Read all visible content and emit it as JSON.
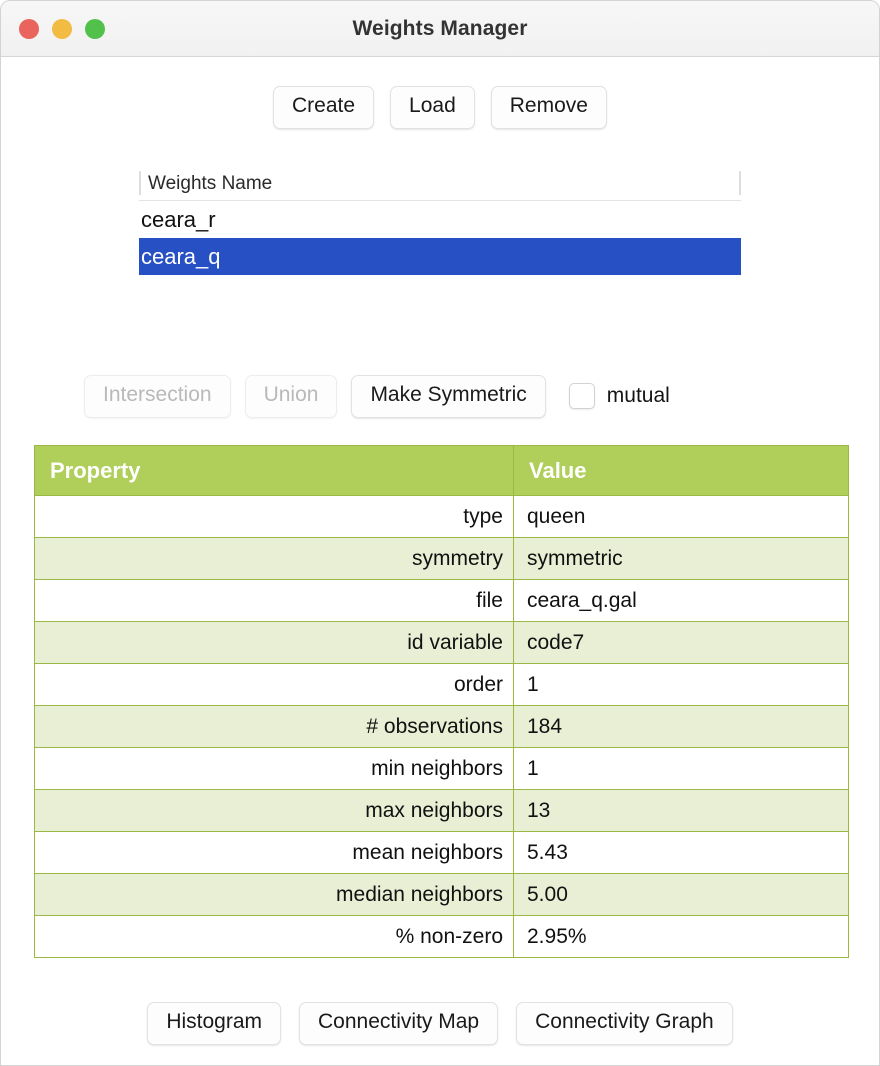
{
  "window": {
    "title": "Weights Manager",
    "traffic_lights": [
      {
        "name": "close-button",
        "color": "#e9645c"
      },
      {
        "name": "minimize-button",
        "color": "#f2bb41"
      },
      {
        "name": "maximize-button",
        "color": "#51c14c"
      }
    ]
  },
  "toolbar": {
    "create_label": "Create",
    "load_label": "Load",
    "remove_label": "Remove"
  },
  "weights_list": {
    "column_header": "Weights Name",
    "rows": [
      {
        "name": "ceara_r",
        "selected": false
      },
      {
        "name": "ceara_q",
        "selected": true
      }
    ],
    "selection_color": "#2750c4"
  },
  "set_operations": {
    "intersection_label": "Intersection",
    "intersection_enabled": false,
    "union_label": "Union",
    "union_enabled": false,
    "make_symmetric_label": "Make Symmetric",
    "make_symmetric_enabled": true,
    "mutual_label": "mutual",
    "mutual_checked": false
  },
  "properties_table": {
    "header_property": "Property",
    "header_value": "Value",
    "header_color": "#b0ce5a",
    "alt_row_color": "#e8efd5",
    "border_color": "#9bb843",
    "rows": [
      {
        "property": "type",
        "value": "queen"
      },
      {
        "property": "symmetry",
        "value": "symmetric"
      },
      {
        "property": "file",
        "value": "ceara_q.gal"
      },
      {
        "property": "id variable",
        "value": "code7"
      },
      {
        "property": "order",
        "value": "1"
      },
      {
        "property": "# observations",
        "value": "184"
      },
      {
        "property": "min neighbors",
        "value": "1"
      },
      {
        "property": "max neighbors",
        "value": "13"
      },
      {
        "property": "mean neighbors",
        "value": "5.43"
      },
      {
        "property": "median neighbors",
        "value": "5.00"
      },
      {
        "property": "% non-zero",
        "value": "2.95%"
      }
    ]
  },
  "bottom_actions": {
    "histogram_label": "Histogram",
    "connectivity_map_label": "Connectivity Map",
    "connectivity_graph_label": "Connectivity Graph"
  }
}
